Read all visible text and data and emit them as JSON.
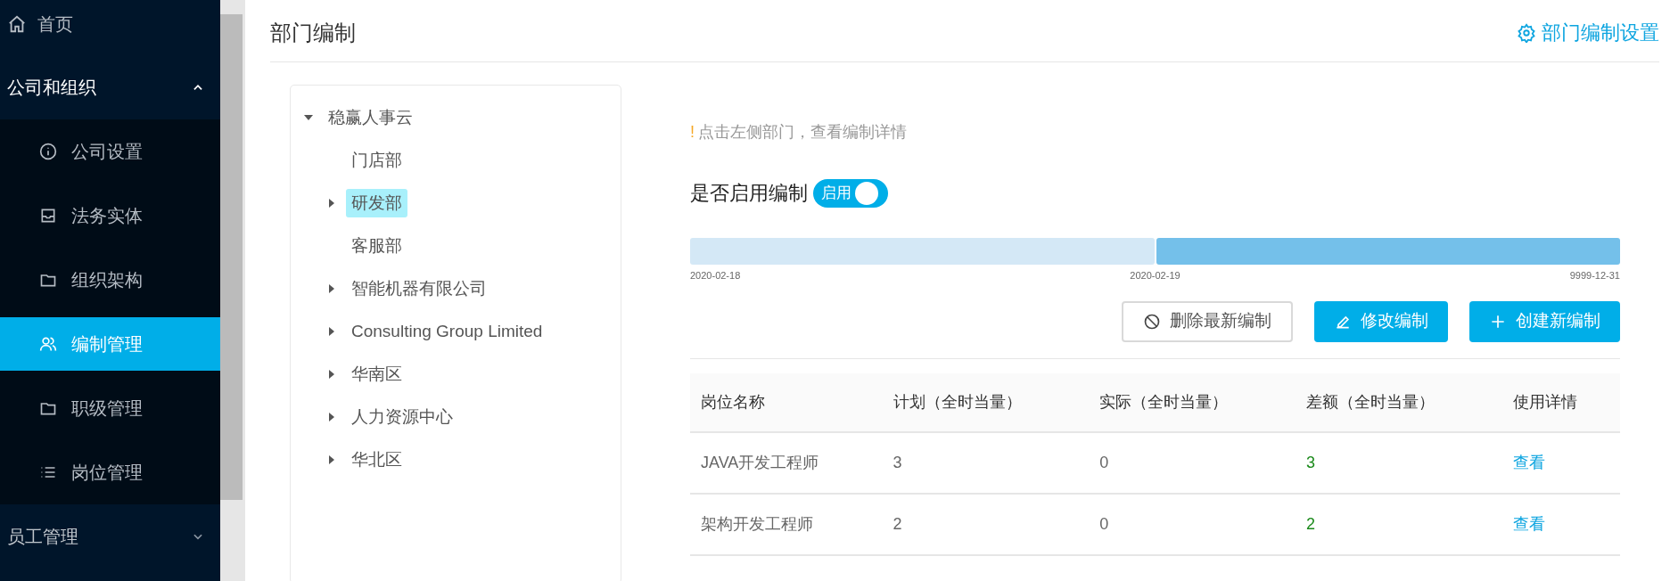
{
  "sidebar": {
    "items": [
      {
        "label": "首页",
        "selected": false
      },
      {
        "label": "公司和组织",
        "expanded": true,
        "children": [
          {
            "label": "公司设置",
            "selected": false
          },
          {
            "label": "法务实体",
            "selected": false
          },
          {
            "label": "组织架构",
            "selected": false
          },
          {
            "label": "编制管理",
            "selected": true
          },
          {
            "label": "职级管理",
            "selected": false
          },
          {
            "label": "岗位管理",
            "selected": false
          }
        ]
      },
      {
        "label": "员工管理",
        "expanded": false
      }
    ]
  },
  "page": {
    "title": "部门编制",
    "settings_link": "部门编制设置"
  },
  "tree": [
    {
      "label": "稳赢人事云",
      "expanded": true,
      "selected": false,
      "children": [
        {
          "label": "门店部",
          "selected": false
        },
        {
          "label": "研发部",
          "expanded": false,
          "selected": true
        },
        {
          "label": "客服部",
          "selected": false
        },
        {
          "label": "智能机器有限公司",
          "expanded": false,
          "selected": false
        },
        {
          "label": "Consulting Group Limited",
          "expanded": false,
          "selected": false
        },
        {
          "label": "华南区",
          "expanded": false,
          "selected": false
        },
        {
          "label": "人力资源中心",
          "expanded": false,
          "selected": false
        },
        {
          "label": "华北区",
          "expanded": false,
          "selected": false
        }
      ]
    }
  ],
  "hint": {
    "mark": "!",
    "text": "点击左侧部门，查看编制详情"
  },
  "enable": {
    "label": "是否启用编制",
    "toggle_label": "启用",
    "on": true
  },
  "timeline": {
    "segments": [
      {
        "selected": false
      },
      {
        "selected": true
      }
    ],
    "dates": [
      "2020-02-18",
      "2020-02-19",
      "9999-12-31"
    ]
  },
  "buttons": [
    {
      "label": "删除最新编制",
      "kind": "outline"
    },
    {
      "label": "修改编制",
      "kind": "primary"
    },
    {
      "label": "创建新编制",
      "kind": "primary"
    }
  ],
  "table": {
    "columns": [
      "岗位名称",
      "计划（全时当量）",
      "实际（全时当量）",
      "差额（全时当量）",
      "使用详情"
    ],
    "rows": [
      [
        "JAVA开发工程师",
        "3",
        "0",
        "3",
        "查看"
      ],
      [
        "架构开发工程师",
        "2",
        "0",
        "2",
        "查看"
      ]
    ]
  }
}
